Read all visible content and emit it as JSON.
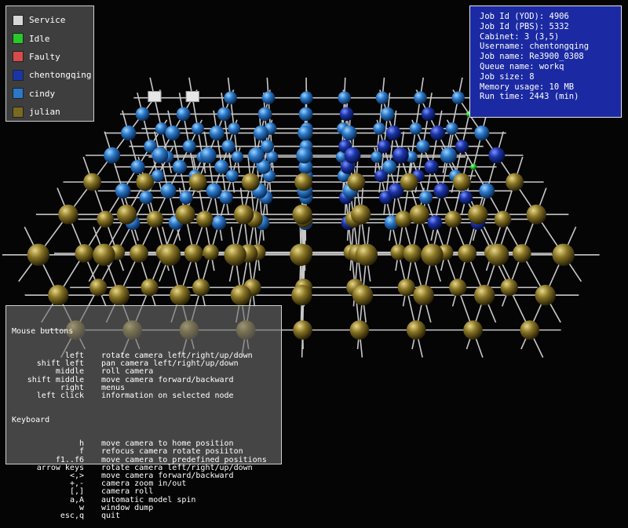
{
  "legend": {
    "items": [
      {
        "label": "Service",
        "color": "#d8d8d8"
      },
      {
        "label": "Idle",
        "color": "#27c92b"
      },
      {
        "label": "Faulty",
        "color": "#d94a4a"
      },
      {
        "label": "chentongqing",
        "color": "#1a35a8"
      },
      {
        "label": "cindy",
        "color": "#2a78c8"
      },
      {
        "label": "julian",
        "color": "#7a6a1e"
      }
    ]
  },
  "job_info": {
    "lines": [
      "Job Id (YOD): 4906",
      "Job Id (PBS): 5332",
      "Cabinet: 3 (3,5)",
      "Username: chentongqing",
      "Job name: Re3900_0308",
      "Queue name: workq",
      "Job size: 8",
      "Memory usage: 10 MB",
      "Run time: 2443 (min)"
    ]
  },
  "help": {
    "mouse_title": "Mouse buttons",
    "mouse": [
      {
        "key": "left",
        "desc": "rotate camera left/right/up/down"
      },
      {
        "key": "shift left",
        "desc": "pan camera left/right/up/down"
      },
      {
        "key": "middle",
        "desc": "roll camera"
      },
      {
        "key": "shift middle",
        "desc": "move camera forward/backward"
      },
      {
        "key": "right",
        "desc": "menus"
      },
      {
        "key": "left click",
        "desc": "information on selected node"
      }
    ],
    "keyboard_title": "Keyboard",
    "keyboard": [
      {
        "key": "h",
        "desc": "move camera to home position"
      },
      {
        "key": "f",
        "desc": "refocus camera rotate posiiton"
      },
      {
        "key": "f1..f6",
        "desc": "move camera to predefined positions"
      },
      {
        "key": "arrow keys",
        "desc": "rotate camera left/right/up/down"
      },
      {
        "key": "<,>",
        "desc": "move camera forward/backward"
      },
      {
        "key": "+,-",
        "desc": "camera zoom in/out"
      },
      {
        "key": "[,]",
        "desc": "camera roll"
      },
      {
        "key": "a,A",
        "desc": "automatic model spin"
      },
      {
        "key": "w",
        "desc": "window dump"
      },
      {
        "key": "esc,q",
        "desc": "quit"
      }
    ]
  }
}
